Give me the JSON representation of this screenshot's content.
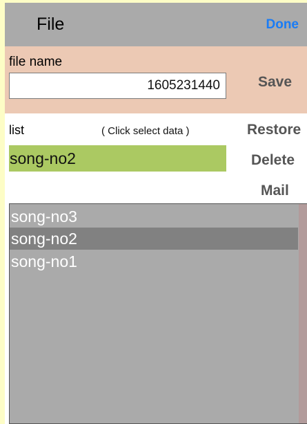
{
  "navbar": {
    "title": "File",
    "done_label": "Done"
  },
  "save_panel": {
    "file_name_label": "file name",
    "file_name_value": "1605231440",
    "save_label": "Save"
  },
  "list_section": {
    "list_label": "list",
    "hint": "( Click select data )",
    "selected_value": "song-no2",
    "restore_label": "Restore",
    "delete_label": "Delete",
    "mail_label": "Mail",
    "items": [
      {
        "label": "song-no3"
      },
      {
        "label": "song-no2"
      },
      {
        "label": "song-no1"
      }
    ]
  },
  "colors": {
    "accent": "#1a7cf5",
    "selected_background": "#abc962",
    "save_panel_background": "#ecc9b4",
    "navbar_background": "#aaaaaa",
    "highlighted_row": "#818181"
  }
}
